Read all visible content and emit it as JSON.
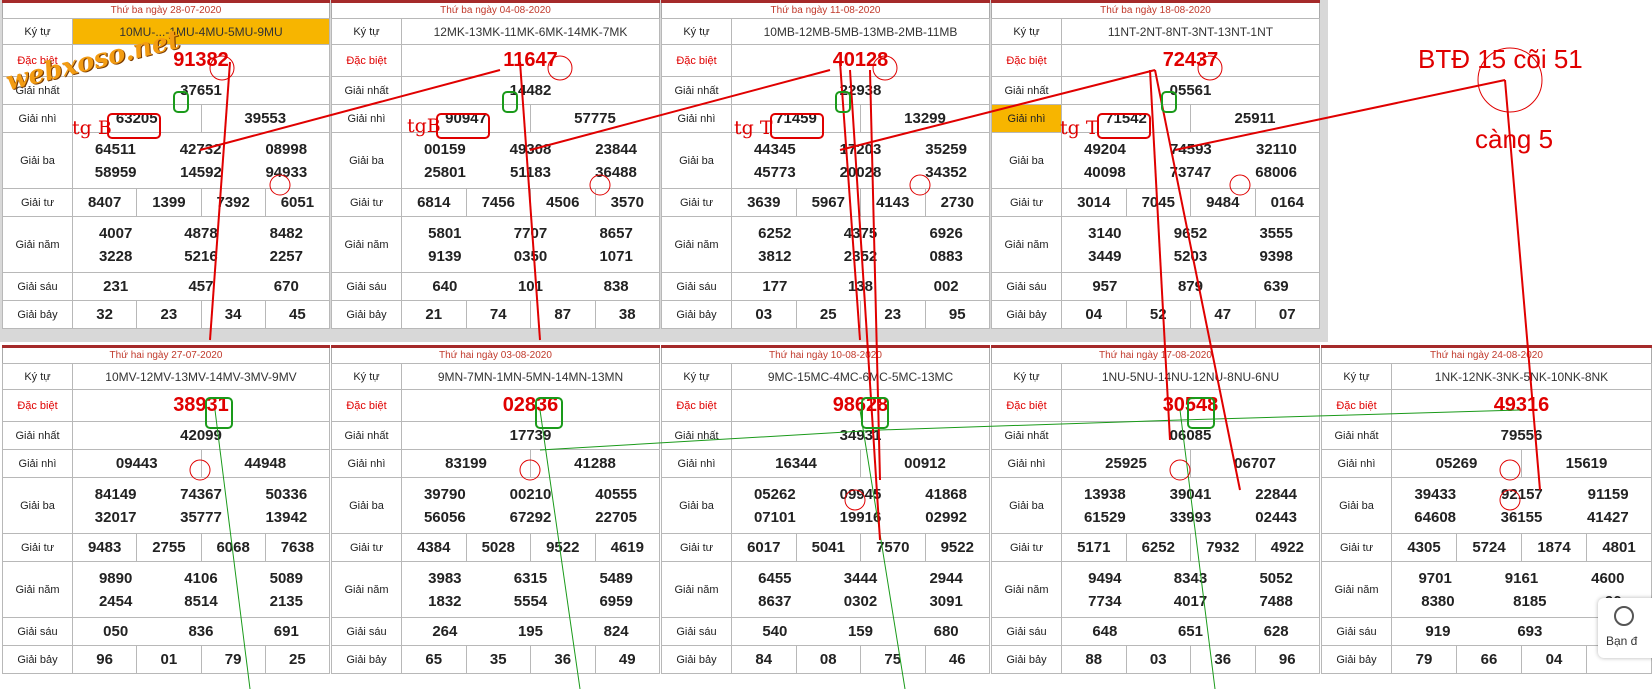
{
  "labels": {
    "ky_tu": "Ký tự",
    "dac_biet": "Đặc biệt",
    "giai_nhat": "Giải nhất",
    "giai_nhi": "Giải nhì",
    "giai_ba": "Giải ba",
    "giai_tu": "Giải tư",
    "giai_nam": "Giải năm",
    "giai_sau": "Giải sáu",
    "giai_bay": "Giải bảy"
  },
  "panels": [
    {
      "date": "Thứ ba ngày 28-07-2020",
      "ky": "10MU-...-1MU-4MU-5MU-9MU",
      "db": "91382",
      "g1": "37651",
      "g2": [
        "63205",
        "39553"
      ],
      "g3": [
        "64511",
        "42732",
        "08998",
        "58959",
        "14592",
        "94933"
      ],
      "g4": [
        "8407",
        "1399",
        "7392",
        "6051"
      ],
      "g5": [
        "4007",
        "4878",
        "8482",
        "3228",
        "5216",
        "2257"
      ],
      "g6": [
        "231",
        "457",
        "670"
      ],
      "g7": [
        "32",
        "23",
        "34",
        "45"
      ]
    },
    {
      "date": "Thứ ba ngày 04-08-2020",
      "ky": "12MK-13MK-11MK-6MK-14MK-7MK",
      "db": "11647",
      "g1": "14482",
      "g2": [
        "90947",
        "57775"
      ],
      "g3": [
        "00159",
        "49308",
        "23844",
        "25801",
        "51183",
        "36488"
      ],
      "g4": [
        "6814",
        "7456",
        "4506",
        "3570"
      ],
      "g5": [
        "5801",
        "7707",
        "8657",
        "9139",
        "0350",
        "1071"
      ],
      "g6": [
        "640",
        "101",
        "838"
      ],
      "g7": [
        "21",
        "74",
        "87",
        "38"
      ]
    },
    {
      "date": "Thứ ba ngày 11-08-2020",
      "ky": "10MB-12MB-5MB-13MB-2MB-11MB",
      "db": "40128",
      "g1": "22938",
      "g2": [
        "71459",
        "13299"
      ],
      "g3": [
        "44345",
        "17203",
        "35259",
        "45773",
        "20028",
        "34352"
      ],
      "g4": [
        "3639",
        "5967",
        "4143",
        "2730"
      ],
      "g5": [
        "6252",
        "4375",
        "6926",
        "3812",
        "2352",
        "0883"
      ],
      "g6": [
        "177",
        "138",
        "002"
      ],
      "g7": [
        "03",
        "25",
        "23",
        "95"
      ]
    },
    {
      "date": "Thứ ba ngày 18-08-2020",
      "ky": "11NT-2NT-8NT-3NT-13NT-1NT",
      "db": "72437",
      "g1": "05561",
      "g2": [
        "71542",
        "25911"
      ],
      "g3": [
        "49204",
        "74593",
        "32110",
        "40098",
        "73747",
        "68006"
      ],
      "g4": [
        "3014",
        "7045",
        "9484",
        "0164"
      ],
      "g5": [
        "3140",
        "9652",
        "3555",
        "3449",
        "5203",
        "9398"
      ],
      "g6": [
        "957",
        "879",
        "639"
      ],
      "g7": [
        "04",
        "52",
        "47",
        "07"
      ]
    },
    {
      "date": "Thứ hai ngày 27-07-2020",
      "ky": "10MV-12MV-13MV-14MV-3MV-9MV",
      "db": "38931",
      "g1": "42099",
      "g2": [
        "09443",
        "44948"
      ],
      "g3": [
        "84149",
        "74367",
        "50336",
        "32017",
        "35777",
        "13942"
      ],
      "g4": [
        "9483",
        "2755",
        "6068",
        "7638"
      ],
      "g5": [
        "9890",
        "4106",
        "5089",
        "2454",
        "8514",
        "2135"
      ],
      "g6": [
        "050",
        "836",
        "691"
      ],
      "g7": [
        "96",
        "01",
        "79",
        "25"
      ]
    },
    {
      "date": "Thứ hai ngày 03-08-2020",
      "ky": "9MN-7MN-1MN-5MN-14MN-13MN",
      "db": "02836",
      "g1": "17739",
      "g2": [
        "83199",
        "41288"
      ],
      "g3": [
        "39790",
        "00210",
        "40555",
        "56056",
        "67292",
        "22705"
      ],
      "g4": [
        "4384",
        "5028",
        "9522",
        "4619"
      ],
      "g5": [
        "3983",
        "6315",
        "5489",
        "1832",
        "5554",
        "6959"
      ],
      "g6": [
        "264",
        "195",
        "824"
      ],
      "g7": [
        "65",
        "35",
        "36",
        "49"
      ]
    },
    {
      "date": "Thứ hai ngày 10-08-2020",
      "ky": "9MC-15MC-4MC-6MC-5MC-13MC",
      "db": "98628",
      "g1": "34931",
      "g2": [
        "16344",
        "00912"
      ],
      "g3": [
        "05262",
        "09945",
        "41868",
        "07101",
        "19916",
        "02992"
      ],
      "g4": [
        "6017",
        "5041",
        "7570",
        "9522"
      ],
      "g5": [
        "6455",
        "3444",
        "2944",
        "8637",
        "0302",
        "3091"
      ],
      "g6": [
        "540",
        "159",
        "680"
      ],
      "g7": [
        "84",
        "08",
        "75",
        "46"
      ]
    },
    {
      "date": "Thứ hai ngày 17-08-2020",
      "ky": "1NU-5NU-14NU-12NU-8NU-6NU",
      "db": "30548",
      "g1": "06085",
      "g2": [
        "25925",
        "06707"
      ],
      "g3": [
        "13938",
        "39041",
        "22844",
        "61529",
        "33993",
        "02443"
      ],
      "g4": [
        "5171",
        "6252",
        "7932",
        "4922"
      ],
      "g5": [
        "9494",
        "8343",
        "5052",
        "7734",
        "4017",
        "7488"
      ],
      "g6": [
        "648",
        "651",
        "628"
      ],
      "g7": [
        "88",
        "03",
        "36",
        "96"
      ]
    },
    {
      "date": "Thứ hai ngày 24-08-2020",
      "ky": "1NK-12NK-3NK-5NK-10NK-8NK",
      "db": "49316",
      "g1": "79556",
      "g2": [
        "05269",
        "15619"
      ],
      "g3": [
        "39433",
        "92157",
        "91159",
        "64608",
        "36155",
        "41427"
      ],
      "g4": [
        "4305",
        "5724",
        "1874",
        "4801"
      ],
      "g5": [
        "9701",
        "9161",
        "4600",
        "8380",
        "8185",
        "90"
      ],
      "g6": [
        "919",
        "693",
        "4"
      ],
      "g7": [
        "79",
        "66",
        "04",
        ""
      ]
    }
  ],
  "annotations": {
    "logo": "webxoso.net",
    "btd": "BTĐ 15 cõi 51",
    "cang": "càng 5",
    "tg": [
      "tg B",
      "tgB",
      "tg T",
      "tg T"
    ]
  },
  "chat_widget": {
    "text": "Bạn đ",
    "icon": "chat-icon"
  }
}
